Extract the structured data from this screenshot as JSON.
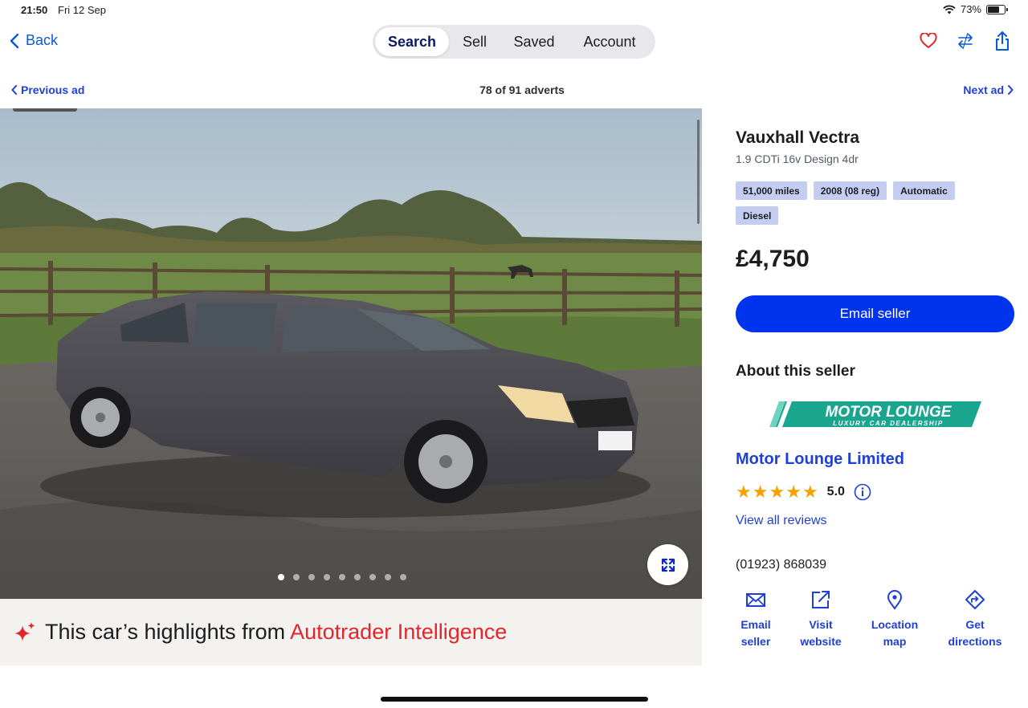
{
  "status_bar": {
    "time": "21:50",
    "date": "Fri 12 Sep",
    "battery_text": "73%",
    "battery_level": 0.73
  },
  "nav": {
    "back_label": "Back",
    "tabs": [
      {
        "label": "Search",
        "active": true
      },
      {
        "label": "Sell",
        "active": false
      },
      {
        "label": "Saved",
        "active": false
      },
      {
        "label": "Account",
        "active": false
      }
    ],
    "icons": [
      "heart-icon",
      "compare-icon",
      "share-icon"
    ]
  },
  "ad_nav": {
    "previous_label": "Previous ad",
    "counter": "78 of 91 adverts",
    "next_label": "Next ad"
  },
  "gallery": {
    "image_count": 9,
    "active_index": 0,
    "expand_icon": "expand-icon"
  },
  "highlights": {
    "text": "This car’s highlights from ",
    "brand": "Autotrader Intelligence"
  },
  "listing": {
    "title": "Vauxhall Vectra",
    "subtitle": "1.9 CDTi 16v Design 4dr",
    "specs": [
      "51,000 miles",
      "2008 (08 reg)",
      "Automatic",
      "Diesel"
    ],
    "price": "£4,750",
    "email_button": "Email seller"
  },
  "seller": {
    "heading": "About this seller",
    "logo_main": "MOTOR LOUNGE",
    "logo_tagline": "LUXURY CAR DEALERSHIP",
    "name": "Motor Lounge Limited",
    "rating": "5.0",
    "stars": 5,
    "reviews_link": "View all reviews",
    "phone": "(01923) 868039",
    "actions": [
      {
        "icon": "mail-icon",
        "line1": "Email",
        "line2": "seller"
      },
      {
        "icon": "external-link-icon",
        "line1": "Visit",
        "line2": "website"
      },
      {
        "icon": "location-pin-icon",
        "line1": "Location",
        "line2": "map"
      },
      {
        "icon": "directions-icon",
        "line1": "Get",
        "line2": "directions"
      }
    ]
  },
  "colors": {
    "accent_blue": "#0033ee",
    "link_blue": "#1f3fd6",
    "brand_red": "#e1262d",
    "chip_bg": "#c4ccf2",
    "star": "#f5a200",
    "logo_teal": "#1aa58f"
  }
}
